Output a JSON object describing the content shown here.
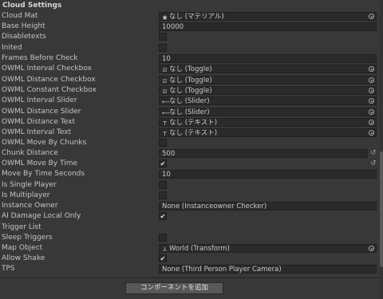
{
  "header": {
    "title": "Cloud Settings"
  },
  "rows": {
    "cloud_mat": {
      "label": "Cloud Mat",
      "value": "なし (マテリアル)",
      "icon": "◉"
    },
    "base_height": {
      "label": "Base Height",
      "value": "10000"
    },
    "disabletexts": {
      "label": "Disabletexts",
      "mark": ""
    },
    "inited": {
      "label": "Inited",
      "mark": ""
    },
    "frames_before_check": {
      "label": "Frames Before Check",
      "value": "10"
    },
    "owml_interval_checkbox": {
      "label": "OWML Interval Checkbox",
      "value": "なし (Toggle)",
      "icon": "☑"
    },
    "owml_distance_checkbox": {
      "label": "OWML Distance Checkbox",
      "value": "なし (Toggle)",
      "icon": "☑"
    },
    "owml_constant_checkbox": {
      "label": "OWML Constant Checkbox",
      "value": "なし (Toggle)",
      "icon": "☑"
    },
    "owml_interval_slider": {
      "label": "OWML Interval Slider",
      "value": "なし (Slider)",
      "icon": "⟵"
    },
    "owml_distance_slider": {
      "label": "OWML Distance Slider",
      "value": "なし (Slider)",
      "icon": "⟵"
    },
    "owml_distance_text": {
      "label": "OWML Distance Text",
      "value": "なし (テキスト)",
      "icon": "T"
    },
    "owml_interval_text": {
      "label": "OWML Interval Text",
      "value": "なし (テキスト)",
      "icon": "T"
    },
    "owml_move_by_chunks": {
      "label": "OWML Move By Chunks",
      "mark": ""
    },
    "chunk_distance": {
      "label": "Chunk Distance",
      "value": "500"
    },
    "owml_move_by_time": {
      "label": "OWML Move By Time",
      "mark": "✔"
    },
    "move_by_time_seconds": {
      "label": "Move By Time Seconds",
      "value": "10"
    },
    "is_single_player": {
      "label": "Is Single Player",
      "mark": ""
    },
    "is_multiplayer": {
      "label": "Is Multiplayer",
      "mark": ""
    },
    "instance_owner": {
      "label": "Instance Owner",
      "value": "None (Instanceowner Checker)"
    },
    "ai_damage_local_only": {
      "label": "AI Damage Local Only",
      "mark": "✔"
    },
    "trigger_list": {
      "label": "Trigger List"
    },
    "sleep_triggers": {
      "label": "Sleep Triggers",
      "mark": ""
    },
    "map_object": {
      "label": "Map Object",
      "value": "World (Transform)",
      "icon": "⅄"
    },
    "allow_shake": {
      "label": "Allow Shake",
      "mark": "✔"
    },
    "tps": {
      "label": "TPS",
      "value": "None (Third Person Player Camera)"
    }
  },
  "revert_icon": "↺",
  "add_component_label": "コンポーネントを追加"
}
